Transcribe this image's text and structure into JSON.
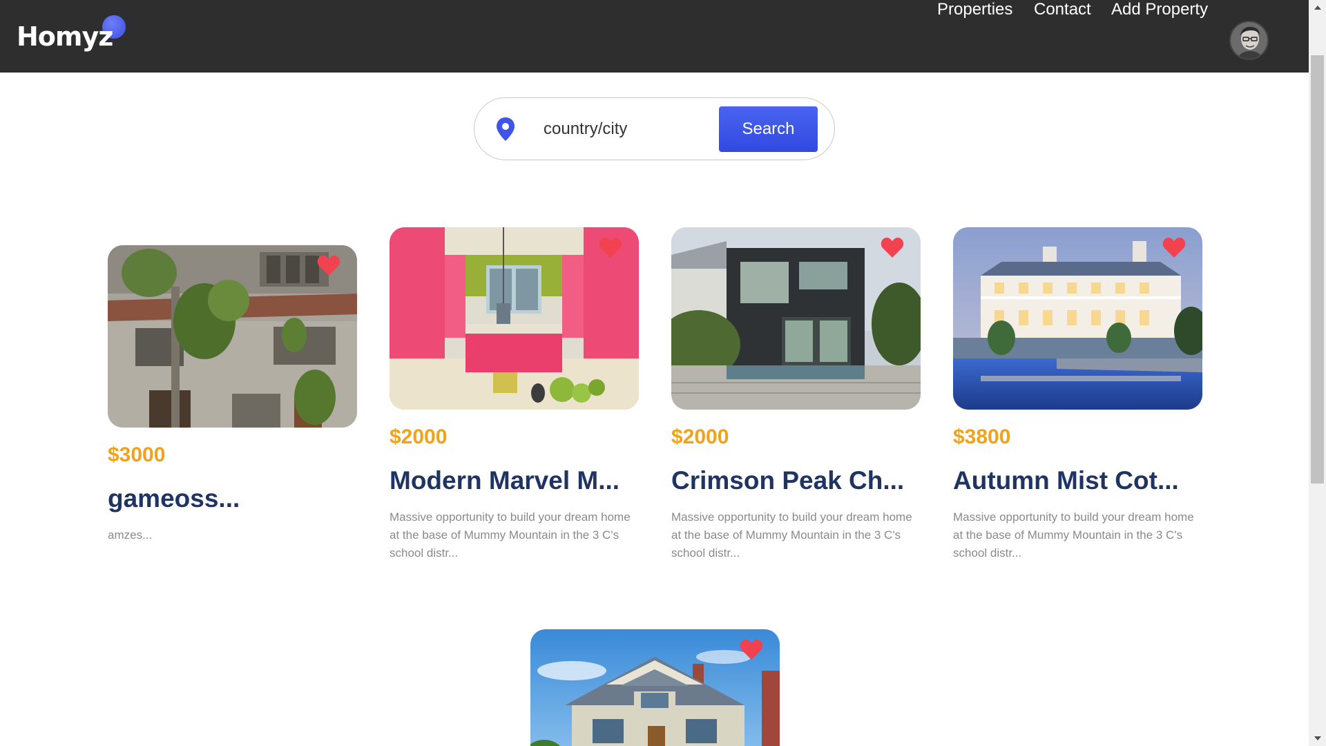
{
  "brand": {
    "logo_text": "Homyz"
  },
  "nav": {
    "properties": "Properties",
    "contact": "Contact",
    "add_property": "Add Property"
  },
  "search": {
    "placeholder": "country/city",
    "value": "",
    "button_label": "Search"
  },
  "colors": {
    "navbar_bg": "#2f2e2f",
    "price": "#f0a21c",
    "title": "#1f3463",
    "accent": "#3a50e6",
    "heart": "#f2414f"
  },
  "properties": [
    {
      "price": "$3000",
      "title": "gameoss...",
      "description": "amzes..."
    },
    {
      "price": "$2000",
      "title": "Modern Marvel M...",
      "description": "Massive opportunity to build your dream home at the base of Mummy Mountain in the 3 C's school distr..."
    },
    {
      "price": "$2000",
      "title": "Crimson Peak Ch...",
      "description": "Massive opportunity to build your dream home at the base of Mummy Mountain in the 3 C's school distr..."
    },
    {
      "price": "$3800",
      "title": "Autumn Mist Cot...",
      "description": "Massive opportunity to build your dream home at the base of Mummy Mountain in the 3 C's school distr..."
    },
    {
      "price": "",
      "title": "",
      "description": ""
    }
  ],
  "icons": {
    "location": "location-pin-icon",
    "favorite": "heart-icon",
    "user": "user-avatar"
  }
}
